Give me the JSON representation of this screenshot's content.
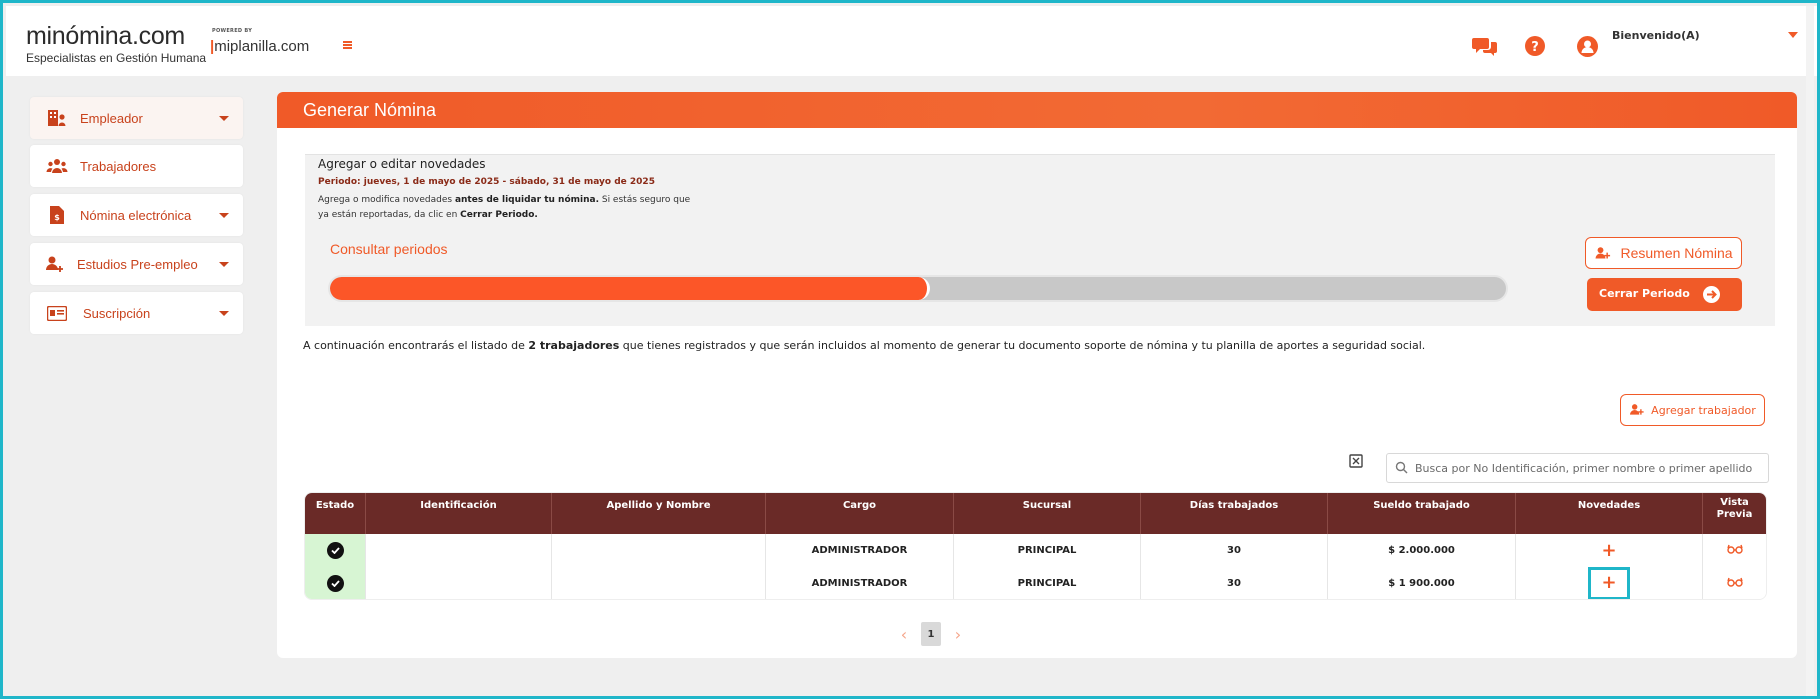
{
  "header": {
    "logo": "minómina.com",
    "logo_sub": "Especialistas en Gestión Humana",
    "powered_by": "POWERED BY",
    "partner": "miplanilla.com",
    "welcome": "Bienvenido(A)",
    "icons": [
      "chat-icon",
      "help-icon",
      "user-icon"
    ],
    "accent_color": "#f05a28"
  },
  "sidebar": {
    "items": [
      {
        "label": "Empleador",
        "icon": "employer-icon",
        "has_caret": true
      },
      {
        "label": "Trabajadores",
        "icon": "workers-icon",
        "has_caret": false
      },
      {
        "label": "Nómina electrónica",
        "icon": "document-icon",
        "has_caret": true
      },
      {
        "label": "Estudios Pre-empleo",
        "icon": "user-add-icon",
        "has_caret": true
      },
      {
        "label": "Suscripción",
        "icon": "card-icon",
        "has_caret": true
      }
    ]
  },
  "page": {
    "title": "Generar Nómina"
  },
  "novedades": {
    "title": "Agregar o editar novedades",
    "period": "Periodo: jueves, 1 de mayo de 2025 - sábado, 31 de mayo de 2025",
    "desc_1": "Agrega o modifica novedades ",
    "desc_bold_1": "antes de liquidar tu nómina.",
    "desc_2": " Si estás seguro que ya están reportadas, da clic en ",
    "desc_bold_2": "Cerrar Periodo.",
    "consult_label": "Consultar periodos",
    "progress_fraction": 0.51,
    "resumen_label": "Resumen Nómina",
    "cerrar_label": "Cerrar Periodo"
  },
  "info": {
    "text_1": "A continuación encontrarás el listado de ",
    "text_bold": "2 trabajadores",
    "text_2": " que tienes registrados y que serán incluidos al momento de generar tu documento soporte de nómina y tu planilla de aportes a seguridad social."
  },
  "toolbar": {
    "add_worker_label": "Agregar trabajador",
    "search_placeholder": "Busca por No Identificación, primer nombre o primer apellido"
  },
  "table": {
    "columns": [
      "Estado",
      "Identificación",
      "Apellido y Nombre",
      "Cargo",
      "Sucursal",
      "Días trabajados",
      "Sueldo trabajado",
      "Novedades",
      "Vista Previa"
    ],
    "rows": [
      {
        "identificacion": "",
        "nombre": "",
        "cargo": "ADMINISTRADOR",
        "sucursal": "PRINCIPAL",
        "dias": "30",
        "sueldo": "$ 2.000.000",
        "novedades": "+",
        "vista": "👓"
      },
      {
        "identificacion": "",
        "nombre": "",
        "cargo": "ADMINISTRADOR",
        "sucursal": "PRINCIPAL",
        "dias": "30",
        "sueldo": "$ 1  900.000",
        "novedades": "+",
        "vista": "👓"
      }
    ]
  },
  "pagination": {
    "current": "1",
    "prev": "‹",
    "next": "›"
  }
}
